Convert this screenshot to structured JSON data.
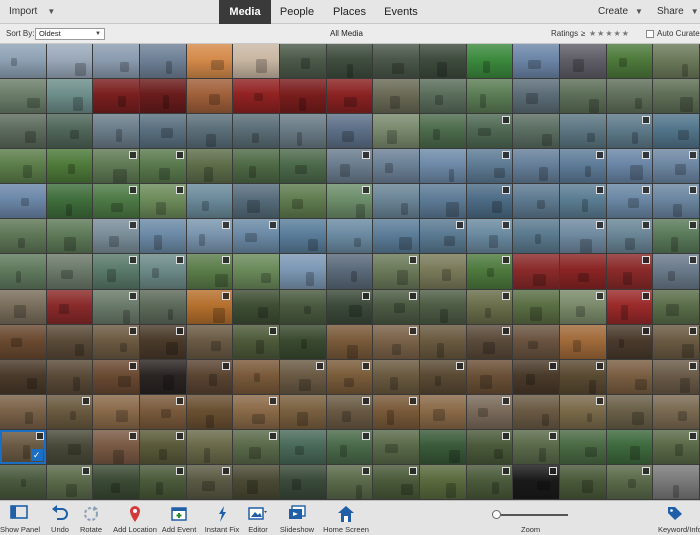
{
  "topbar": {
    "import_label": "Import",
    "tabs": [
      {
        "label": "Media",
        "active": true
      },
      {
        "label": "People",
        "active": false
      },
      {
        "label": "Places",
        "active": false
      },
      {
        "label": "Events",
        "active": false
      }
    ],
    "create_label": "Create",
    "share_label": "Share"
  },
  "sortbar": {
    "sort_label": "Sort By:",
    "sort_value": "Oldest",
    "view_title": "All Media",
    "ratings_label": "Ratings",
    "ratings_operator": "≥",
    "ratings_stars": "★★★★★",
    "auto_curate_label": "Auto Curate",
    "auto_curate_checked": false
  },
  "grid": {
    "rows": 13,
    "cols": 15,
    "selected_index": 165,
    "tile_colors": [
      "#8ea2b5",
      "#9aa9ba",
      "#8b9cb0",
      "#6f8196",
      "#d58a4a",
      "#c9b7a3",
      "#4c5a4a",
      "#3f4e3f",
      "#4a574a",
      "#3e4c3d",
      "#3c8a3e",
      "#6c86a8",
      "#5f5e67",
      "#4e7a3c",
      "#6c7a5a",
      "#6b7e6a",
      "#6d8e8a",
      "#7a1f1f",
      "#6a1c1c",
      "#a0603a",
      "#922222",
      "#7a1d1d",
      "#8b2222",
      "#6a6a56",
      "#5a6d5b",
      "#5b7d55",
      "#5c6d77",
      "#5d6f58",
      "#60705a",
      "#5f6f57",
      "#5d6b5e",
      "#50665a",
      "#6b7d8a",
      "#5a7080",
      "#5b6f7a",
      "#5b6d76",
      "#6a7b86",
      "#5d7088",
      "#7a8a6e",
      "#4d6b4d",
      "#4f6954",
      "#5b6e62",
      "#5c7682",
      "#5e7a8a",
      "#52758b",
      "#5c7e4a",
      "#4e7a3a",
      "#607a55",
      "#5a7a4e",
      "#5e6e4a",
      "#4f6a46",
      "#4d6a4c",
      "#6a7d8e",
      "#6c8196",
      "#6e8aa8",
      "#5e7b95",
      "#667f9a",
      "#5e7c98",
      "#6a86a6",
      "#6d87a2",
      "#6b87a8",
      "#3f6e3c",
      "#4d7a46",
      "#6c8b5a",
      "#6a8a9a",
      "#566c7b",
      "#607c4f",
      "#6c8e6a",
      "#6a8596",
      "#5d7b96",
      "#4d6c86",
      "#5e7a90",
      "#5b7d92",
      "#6a87a4",
      "#6b86a0",
      "#5f7757",
      "#5e7a58",
      "#7a8e9a",
      "#6b8aa6",
      "#7a95ae",
      "#6b8aa6",
      "#5a7d9a",
      "#6b8ba2",
      "#5c7d98",
      "#5a7a92",
      "#6a8aa0",
      "#5b7a8e",
      "#708aa0",
      "#6a8696",
      "#5a7a5a",
      "#607a5e",
      "#6b7a6a",
      "#5a7a6a",
      "#6c8a88",
      "#5b7d4a",
      "#6a8a5a",
      "#7c98b4",
      "#5a6a7a",
      "#6b7a5a",
      "#7a7a5a",
      "#4e7a3e",
      "#8a2a2a",
      "#8a2424",
      "#8b2a2a",
      "#6a7a8a",
      "#7a6e5c",
      "#8a2a2a",
      "#6a7a6a",
      "#5d6a5a",
      "#b5702d",
      "#3e4e34",
      "#4a5a40",
      "#3b4a3a",
      "#4c5b44",
      "#4e5d46",
      "#6a6e4a",
      "#5a6e44",
      "#7a8a6a",
      "#9a2a2a",
      "#5a6e4a",
      "#6a4a30",
      "#5a4a38",
      "#6c5a42",
      "#4a3a2a",
      "#6a5a44",
      "#4e5a3a",
      "#3a4a30",
      "#7a5a3a",
      "#7a6248",
      "#6a5a40",
      "#5a4a3a",
      "#6a5440",
      "#a06a3a",
      "#4a3a2c",
      "#6a5a42",
      "#4a3a2a",
      "#5a4a38",
      "#6a4a32",
      "#2a2422",
      "#5a4432",
      "#7a5a3a",
      "#6a5a44",
      "#7a5c3a",
      "#6a5a40",
      "#5a4a34",
      "#6a5036",
      "#4a3a2a",
      "#5a4a32",
      "#7a5e42",
      "#6a5a48",
      "#7a6248",
      "#6a5a40",
      "#8a6a4a",
      "#7a5a3c",
      "#6a5032",
      "#8a6a48",
      "#7a6040",
      "#6a5a44",
      "#7a5a3a",
      "#8a6a48",
      "#7a6a5a",
      "#6a5a44",
      "#7a6a4a",
      "#6a6048",
      "#7a6a52",
      "#6a5a44",
      "#4a4a3a",
      "#7a5a44",
      "#5a5a3a",
      "#6a6a4a",
      "#5a6a4a",
      "#4a6a5a",
      "#4a6a4a",
      "#5a6a4a",
      "#3a5a3a",
      "#4a5a3a",
      "#5a6a4a",
      "#4a6a44",
      "#3e6a3e",
      "#5a6a48",
      "#4a5a3e",
      "#5a6a4a",
      "#3a4a34",
      "#4a5a3a",
      "#5a5a44",
      "#4a4a34",
      "#3a4a3a",
      "#5a6a4a",
      "#4a5a3a",
      "#5a6a3e",
      "#4a5a3a",
      "#1a1a1a",
      "#4a5a3a",
      "#5a6a4a",
      "#7a7a7a"
    ],
    "badge_indices": [
      40,
      43,
      47,
      48,
      52,
      55,
      57,
      58,
      59,
      62,
      63,
      67,
      70,
      72,
      73,
      74,
      77,
      79,
      80,
      84,
      85,
      87,
      88,
      89,
      92,
      93,
      94,
      98,
      100,
      103,
      104,
      107,
      109,
      112,
      113,
      115,
      117,
      118,
      122,
      123,
      125,
      128,
      130,
      133,
      134,
      137,
      139,
      141,
      142,
      144,
      146,
      147,
      149,
      151,
      153,
      155,
      157,
      158,
      160,
      162,
      165,
      167,
      168,
      170,
      172,
      175,
      176,
      179,
      181,
      183,
      184,
      187,
      188,
      190,
      191,
      193
    ]
  },
  "toolbar": {
    "items": [
      {
        "label": "Show Panel",
        "icon": "show-panel-icon"
      },
      {
        "label": "Undo",
        "icon": "undo-icon"
      },
      {
        "label": "Rotate",
        "icon": "rotate-icon"
      },
      {
        "label": "Add Location",
        "icon": "map-pin-icon"
      },
      {
        "label": "Add Event",
        "icon": "calendar-icon"
      },
      {
        "label": "Instant Fix",
        "icon": "magic-wand-icon"
      },
      {
        "label": "Editor",
        "icon": "editor-icon"
      },
      {
        "label": "Slideshow",
        "icon": "slideshow-icon"
      },
      {
        "label": "Home Screen",
        "icon": "home-icon"
      }
    ],
    "zoom_label": "Zoom",
    "zoom_value": 0.0,
    "right_label": "Keyword/Info"
  },
  "colors": {
    "accent": "#1a6fc4",
    "topbar_bg": "#e6e6e6",
    "active_tab_bg": "#3a3a3a",
    "toolbar_bg": "#e4e4e4"
  }
}
